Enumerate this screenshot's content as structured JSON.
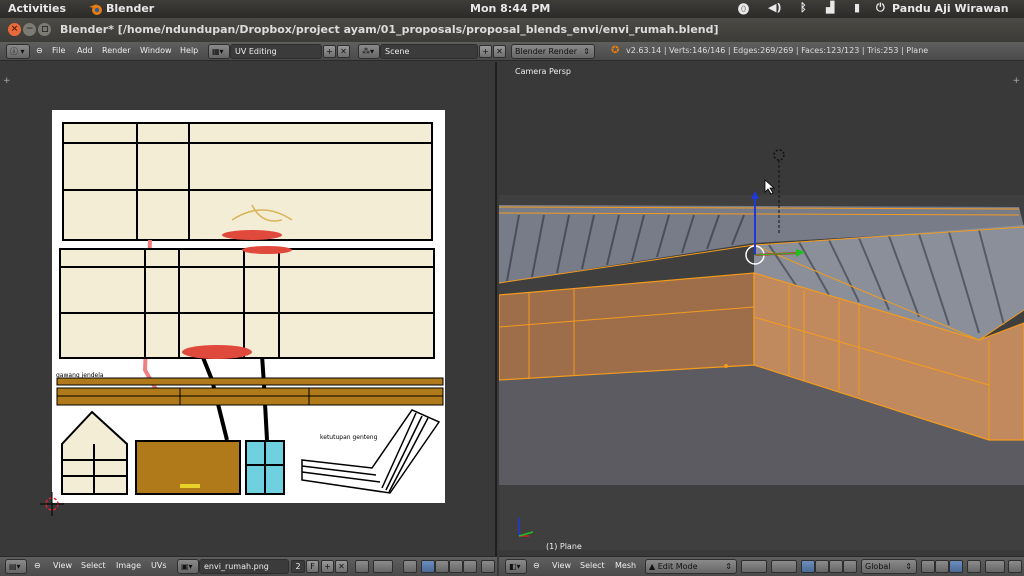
{
  "top_panel": {
    "activities": "Activities",
    "app_name": "Blender",
    "clock": "Mon  8:44 PM",
    "user": "Pandu Aji Wirawan",
    "tray_icons": [
      "accessibility-icon",
      "volume-icon",
      "bluetooth-icon",
      "network-icon",
      "battery-icon",
      "power-icon"
    ]
  },
  "window": {
    "title": "Blender* [/home/ndundupan/Dropbox/project ayam/01_proposals/proposal_blends_envi/envi_rumah.blend]",
    "close": "×",
    "minimize": "−"
  },
  "info_header": {
    "menus": [
      "File",
      "Add",
      "Render",
      "Window",
      "Help"
    ],
    "screen_layout": "UV Editing",
    "scene": "Scene",
    "render_engine": "Blender Render",
    "stats": "v2.63.14 | Verts:146/146 | Edges:269/269 | Faces:123/123 | Tris:253 | Plane"
  },
  "uv_editor": {
    "image_labels": {
      "frame": "gawang jendela",
      "roof_cover": "ketutupan genteng"
    },
    "header": {
      "menus": [
        "View",
        "Select",
        "Image",
        "UVs"
      ],
      "image_name": "envi_rumah.png",
      "users": "2",
      "fake_user": "F"
    }
  },
  "viewport": {
    "view_label": "Camera Persp",
    "object_label": "(1) Plane",
    "header": {
      "menus": [
        "View",
        "Select",
        "Mesh"
      ],
      "mode": "Edit Mode",
      "orientation": "Global"
    }
  },
  "colors": {
    "accent_selection": "#f39b1e",
    "texture_wood": "#b07a1a",
    "texture_paper": "#f4edd6"
  }
}
